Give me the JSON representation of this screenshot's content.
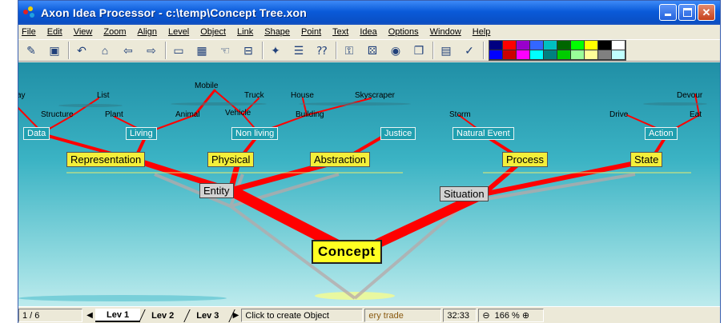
{
  "window": {
    "title": "Axon Idea Processor - c:\\temp\\Concept Tree.xon",
    "controls": [
      "minimize",
      "maximize",
      "close"
    ]
  },
  "menu": [
    "File",
    "Edit",
    "View",
    "Zoom",
    "Align",
    "Level",
    "Object",
    "Link",
    "Shape",
    "Point",
    "Text",
    "Idea",
    "Options",
    "Window",
    "Help"
  ],
  "toolbar": {
    "buttons": [
      {
        "name": "open-icon",
        "glyph": "✎"
      },
      {
        "name": "save-icon",
        "glyph": "▣"
      },
      {
        "name": "undo-icon",
        "glyph": "↶"
      },
      {
        "name": "home-icon",
        "glyph": "⌂"
      },
      {
        "name": "back-icon",
        "glyph": "⇦"
      },
      {
        "name": "forward-icon",
        "glyph": "⇨"
      },
      {
        "name": "window-icon",
        "glyph": "▭"
      },
      {
        "name": "chart-icon",
        "glyph": "▦"
      },
      {
        "name": "hand-icon",
        "glyph": "☜"
      },
      {
        "name": "link-icon",
        "glyph": "⊟"
      },
      {
        "name": "tool-icon",
        "glyph": "✦"
      },
      {
        "name": "list-icon",
        "glyph": "☰"
      },
      {
        "name": "question-icon",
        "glyph": "⁇"
      },
      {
        "name": "key-icon",
        "glyph": "⚿"
      },
      {
        "name": "dice-icon",
        "glyph": "⚄"
      },
      {
        "name": "globe-icon",
        "glyph": "◉"
      },
      {
        "name": "copy-icon",
        "glyph": "❐"
      },
      {
        "name": "grid-icon",
        "glyph": "▤"
      },
      {
        "name": "check-icon",
        "glyph": "✓"
      }
    ],
    "palette": [
      "#000080",
      "#ff0000",
      "#9900cc",
      "#3366ff",
      "#00c0c0",
      "#006600",
      "#00ff00",
      "#ffff00",
      "#000000",
      "#ffffff",
      "#0000ff",
      "#cc0000",
      "#ff00ff",
      "#00ffff",
      "#008080",
      "#00cc00",
      "#99ff99",
      "#ffff99",
      "#808080",
      "#c0ffff"
    ]
  },
  "canvas": {
    "root": "Concept",
    "mid_nodes": [
      "Entity",
      "Situation"
    ],
    "yellow_nodes": [
      "Representation",
      "Physical",
      "Abstraction",
      "Process",
      "State"
    ],
    "teal_nodes": [
      "Data",
      "Living",
      "Non living",
      "Justice",
      "Natural Event",
      "Action"
    ],
    "leaf_labels": [
      "ay",
      "List",
      "Structure",
      "Plant",
      "Animal",
      "Mobile",
      "Truck",
      "Vehicle",
      "House",
      "Building",
      "Skyscraper",
      "Storm",
      "Drive",
      "Devour",
      "Eat"
    ]
  },
  "status": {
    "page": "1 / 6",
    "levels": [
      "Lev 1",
      "Lev 2",
      "Lev 3"
    ],
    "hint": "Click to create Object",
    "trade_text": "ery trade",
    "time": "32:33",
    "zoom": "166 %"
  }
}
